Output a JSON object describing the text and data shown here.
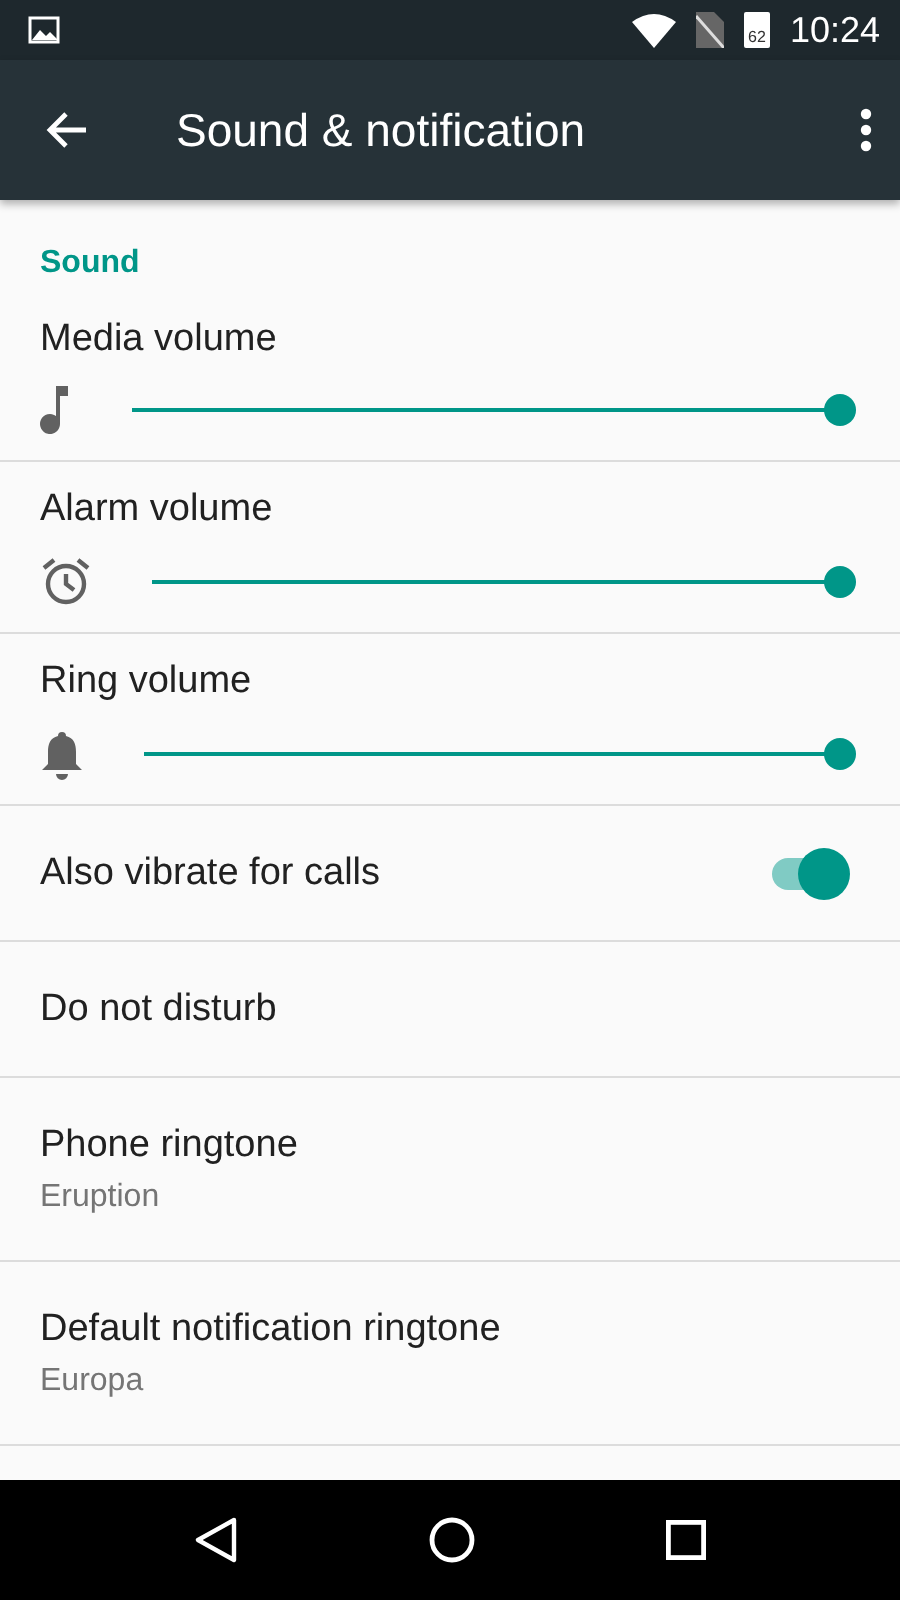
{
  "status_bar": {
    "battery": "62",
    "time": "10:24"
  },
  "app_bar": {
    "title": "Sound & notification"
  },
  "section": {
    "title": "Sound"
  },
  "items": [
    {
      "kind": "slider",
      "label": "Media volume",
      "level": 1
    },
    {
      "kind": "slider",
      "label": "Alarm volume",
      "level": 1
    },
    {
      "kind": "slider",
      "label": "Ring volume",
      "level": 1
    },
    {
      "kind": "switch",
      "label": "Also vibrate for calls",
      "on": true
    },
    {
      "kind": "plain",
      "label": "Do not disturb"
    },
    {
      "kind": "subtitle",
      "label": "Phone ringtone",
      "summary": "Eruption"
    },
    {
      "kind": "subtitle",
      "label": "Default notification ringtone",
      "summary": "Europa"
    }
  ]
}
